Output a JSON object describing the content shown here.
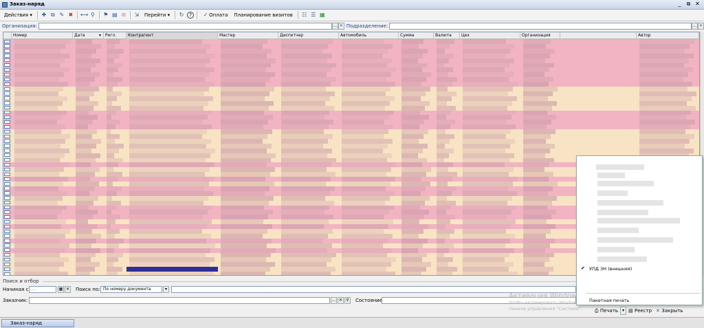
{
  "window": {
    "title": "Заказ-наряд",
    "controls": [
      "_",
      "⧉",
      "✕"
    ]
  },
  "toolbar": {
    "actions_label": "Действия",
    "goto_label": "Перейти",
    "payment_label": "Оплата",
    "visits_label": "Планирование визитов",
    "help_label": "?"
  },
  "filters": {
    "organization_label": "Организация:",
    "subdivision_label": "Подразделение:",
    "organization_value": "",
    "subdivision_value": ""
  },
  "grid": {
    "columns": [
      "Номер",
      "Дата",
      "Регл.",
      "Контрагент",
      "Мастер",
      "Диспетчер",
      "Автомобиль",
      "Сумма",
      "Валюта",
      "Цех",
      "Организация",
      "",
      "Автор"
    ],
    "sort_column": "Дата",
    "selected_column": "Контрагент",
    "row_count": 50
  },
  "search": {
    "section_label": "Поиск и отбор",
    "start_label": "Начиная с:",
    "start_value": ". .",
    "search_by_label": "Поиск по:",
    "search_by_value": "По номеру документа",
    "customer_label": "Заказчик:",
    "state_label": "Состояние:"
  },
  "print_menu": {
    "checked_item": "УПД ЗН (внешняя)",
    "batch_item": "Пакетная печать"
  },
  "bottom": {
    "print_label": "Печать",
    "registry_label": "Реестр",
    "close_label": "Закрыть"
  },
  "watermark": {
    "line1": "Активация Windows",
    "line2": "Чтобы активировать Windows, перейдите в компонент",
    "line3": "панели управления \"Система\"."
  },
  "taskbar": {
    "tab_label": "Заказ-наряд"
  },
  "colors": {
    "row_pink": "#f2b4c3",
    "row_beige": "#f8e4c4",
    "blur_mauve": "#c99aa6",
    "accent_blue": "#2d5aa0"
  }
}
